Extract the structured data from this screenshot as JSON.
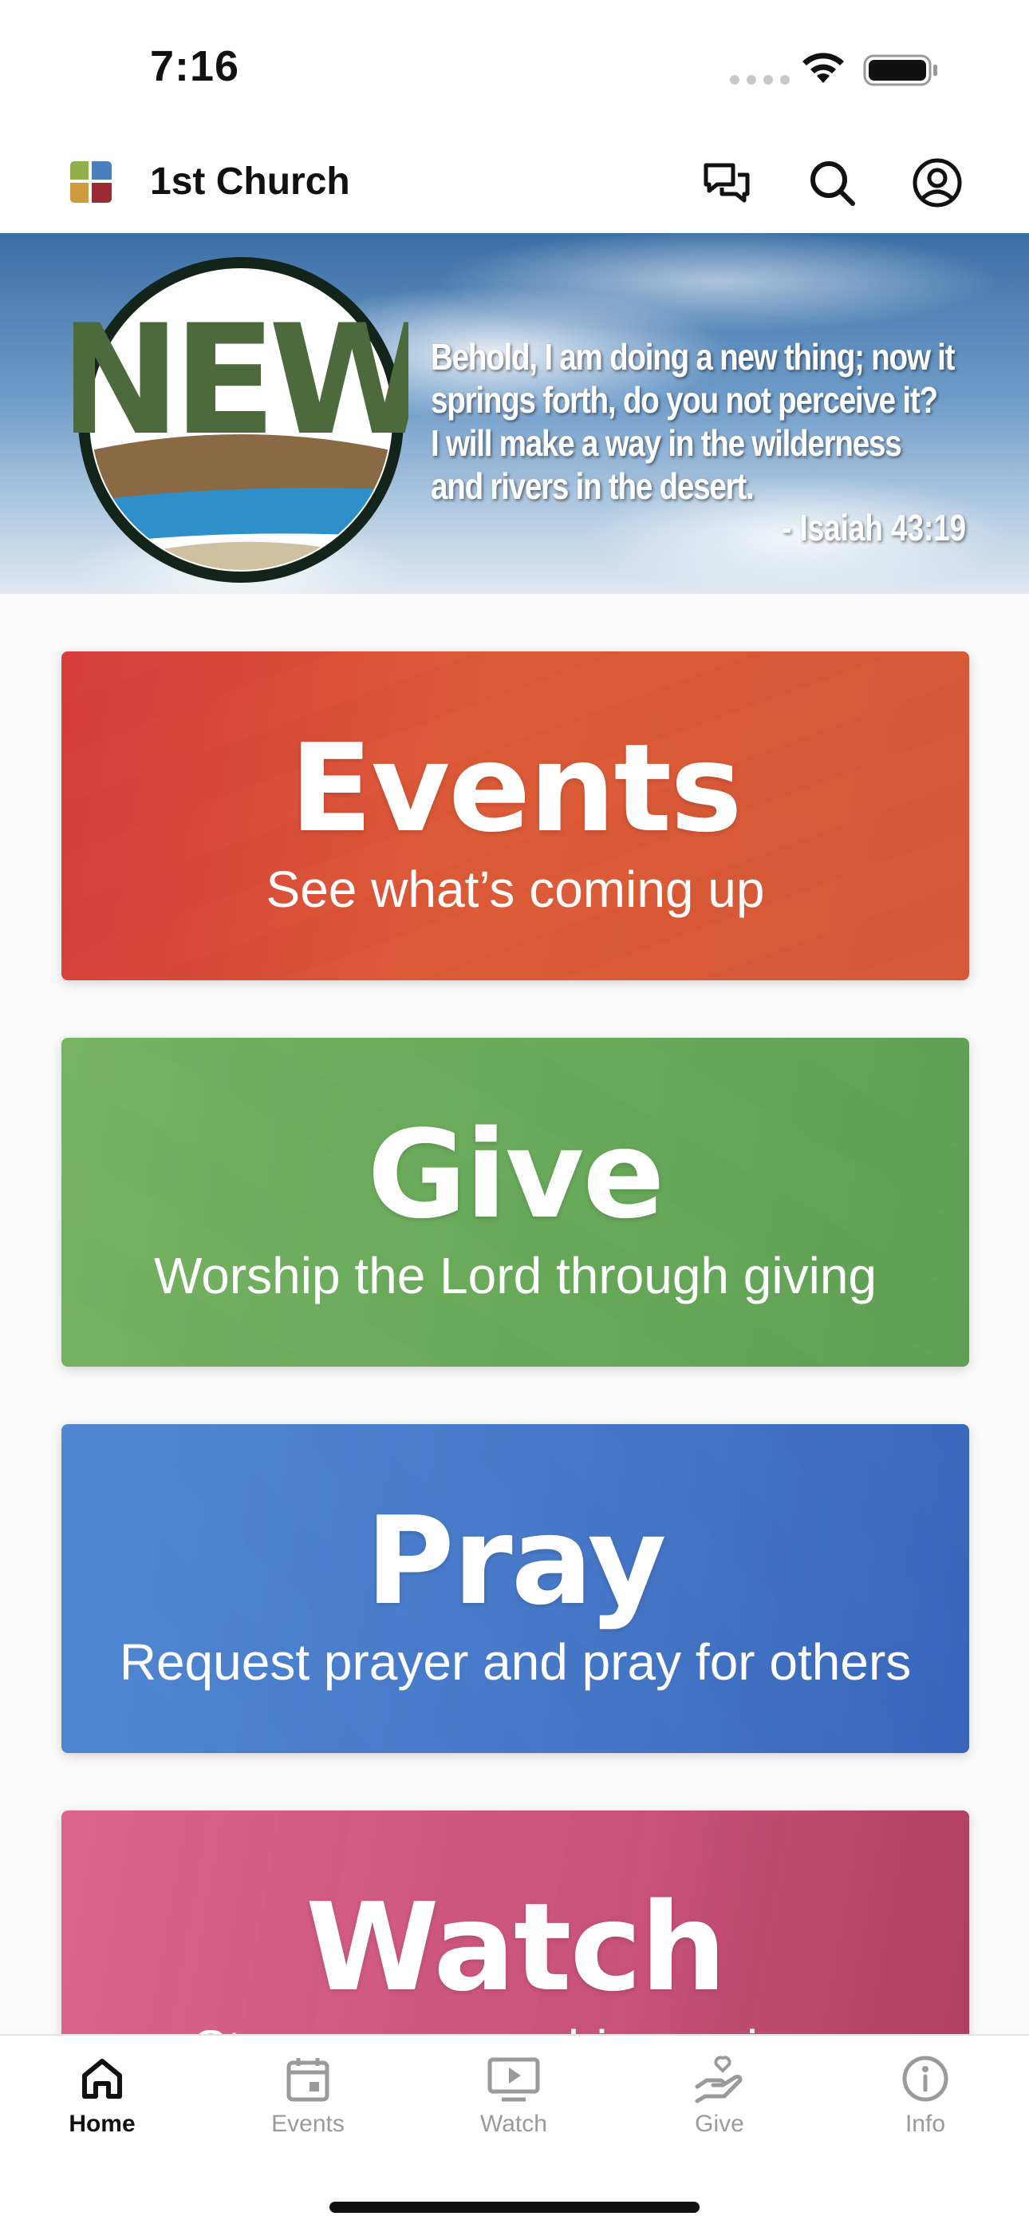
{
  "status": {
    "time": "7:16"
  },
  "header": {
    "title": "1st Church",
    "icons": [
      "chat-icon",
      "search-icon",
      "profile-icon"
    ]
  },
  "banner": {
    "badge_text": "NEW",
    "verse_lines": [
      "Behold, I am doing a new thing; now it",
      "springs forth, do you not perceive it?",
      "I will make a way in the wilderness",
      "and rivers in the desert."
    ],
    "reference": "- Isaiah 43:19"
  },
  "cards": [
    {
      "title": "Events",
      "subtitle": "See what’s coming up",
      "color": "#d94f3d"
    },
    {
      "title": "Give",
      "subtitle": "Worship the Lord through giving",
      "color": "#6fb05e"
    },
    {
      "title": "Pray",
      "subtitle": "Request prayer and pray for others",
      "color": "#4a80cc"
    },
    {
      "title": "Watch",
      "subtitle": "Stream our worship services",
      "color": "#cf6a8e"
    }
  ],
  "tabs": [
    {
      "label": "Home",
      "icon": "home-icon",
      "active": true
    },
    {
      "label": "Events",
      "icon": "calendar-icon",
      "active": false
    },
    {
      "label": "Watch",
      "icon": "video-icon",
      "active": false
    },
    {
      "label": "Give",
      "icon": "give-icon",
      "active": false
    },
    {
      "label": "Info",
      "icon": "info-icon",
      "active": false
    }
  ]
}
